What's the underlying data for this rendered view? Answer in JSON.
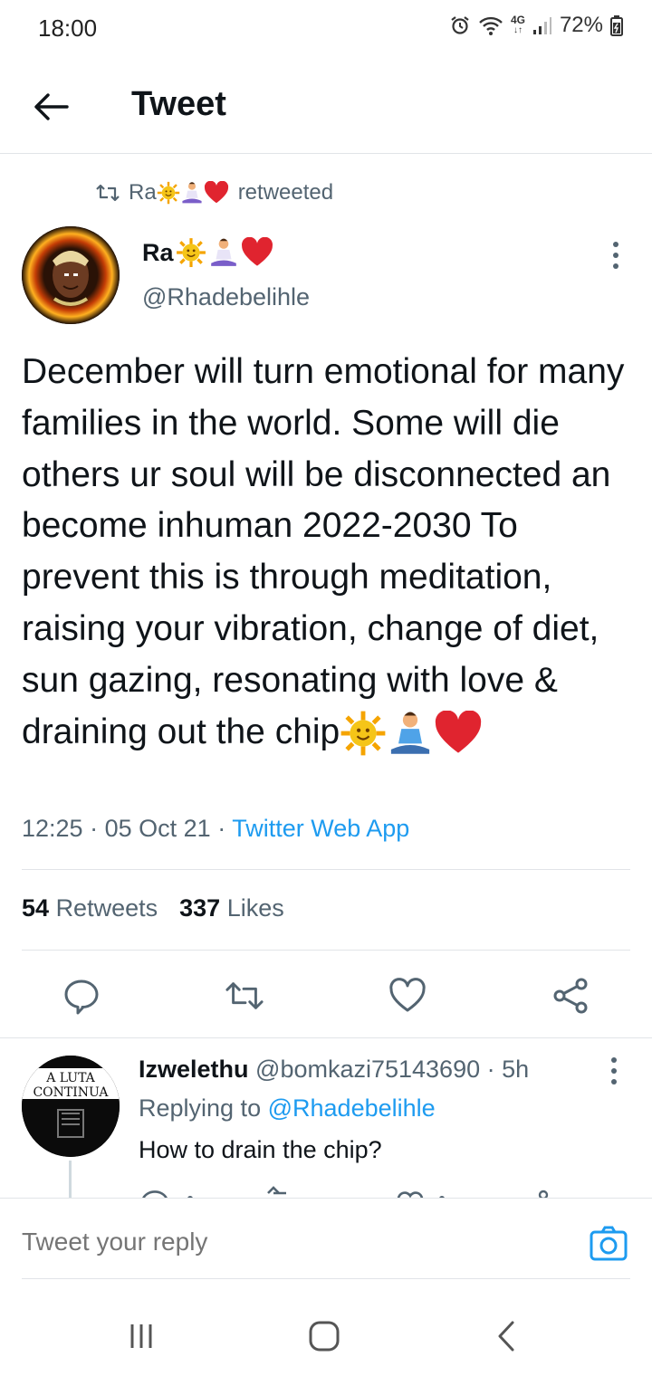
{
  "status_bar": {
    "time": "18:00",
    "network": "4G",
    "battery": "72%",
    "icons": [
      "alarm-icon",
      "wifi-icon",
      "signal-icon",
      "battery-icon"
    ]
  },
  "header": {
    "title": "Tweet"
  },
  "retweet": {
    "retweeter_name": "Ra",
    "label": "retweeted"
  },
  "tweet": {
    "author_name": "Ra",
    "author_handle": "@Rhadebelihle",
    "text": "December will turn emotional for many families in the world. Some will die others ur soul will be disconnected an become inhuman 2022-2030 To prevent this is through meditation, raising your vibration, change of diet, sun gazing, resonating with love & draining out the chip",
    "time": "12:25",
    "sep1": "·",
    "date": "05 Oct 21",
    "sep2": "·",
    "source": "Twitter Web App",
    "retweets_count": "54",
    "retweets_label": "Retweets",
    "likes_count": "337",
    "likes_label": "Likes"
  },
  "reply": {
    "name": "Izwelethu",
    "handle": "@bomkazi75143690",
    "sep": "·",
    "age": "5h",
    "replying_prefix": "Replying to",
    "replying_to": "@Rhadebelihle",
    "text": "How to drain the chip?",
    "avatar_text_top": "A LUTA",
    "avatar_text_bottom": "CONTINUA"
  },
  "compose": {
    "placeholder": "Tweet your reply"
  },
  "colors": {
    "accent": "#1d9bf0",
    "text": "#0f1419",
    "secondary": "#536471",
    "heart": "#e0242f",
    "sun": "#f5c518"
  }
}
